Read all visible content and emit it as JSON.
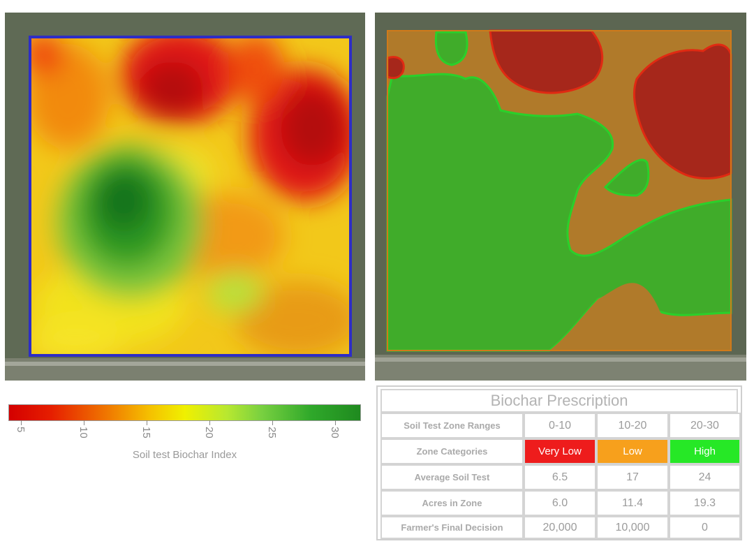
{
  "colors": {
    "very_low": "#ee1c1c",
    "low": "#f7a01c",
    "high": "#26e826",
    "boundary": "#2d2dc6"
  },
  "colorbar": {
    "title": "Soil test Biochar Index",
    "ticks": [
      "5",
      "10",
      "15",
      "20",
      "25",
      "30"
    ]
  },
  "prescription": {
    "title": "Biochar Prescription",
    "rows": [
      {
        "label": "Soil Test Zone Ranges",
        "values": [
          "0-10",
          "10-20",
          "20-30"
        ]
      },
      {
        "label": "Zone Categories",
        "values": [
          "Very Low",
          "Low",
          "High"
        ]
      },
      {
        "label": "Average Soil Test",
        "values": [
          "6.5",
          "17",
          "24"
        ]
      },
      {
        "label": "Acres in Zone",
        "values": [
          "6.0",
          "11.4",
          "19.3"
        ]
      },
      {
        "label": "Farmer's Final Decision",
        "values": [
          "20,000",
          "10,000",
          "0"
        ]
      }
    ]
  }
}
